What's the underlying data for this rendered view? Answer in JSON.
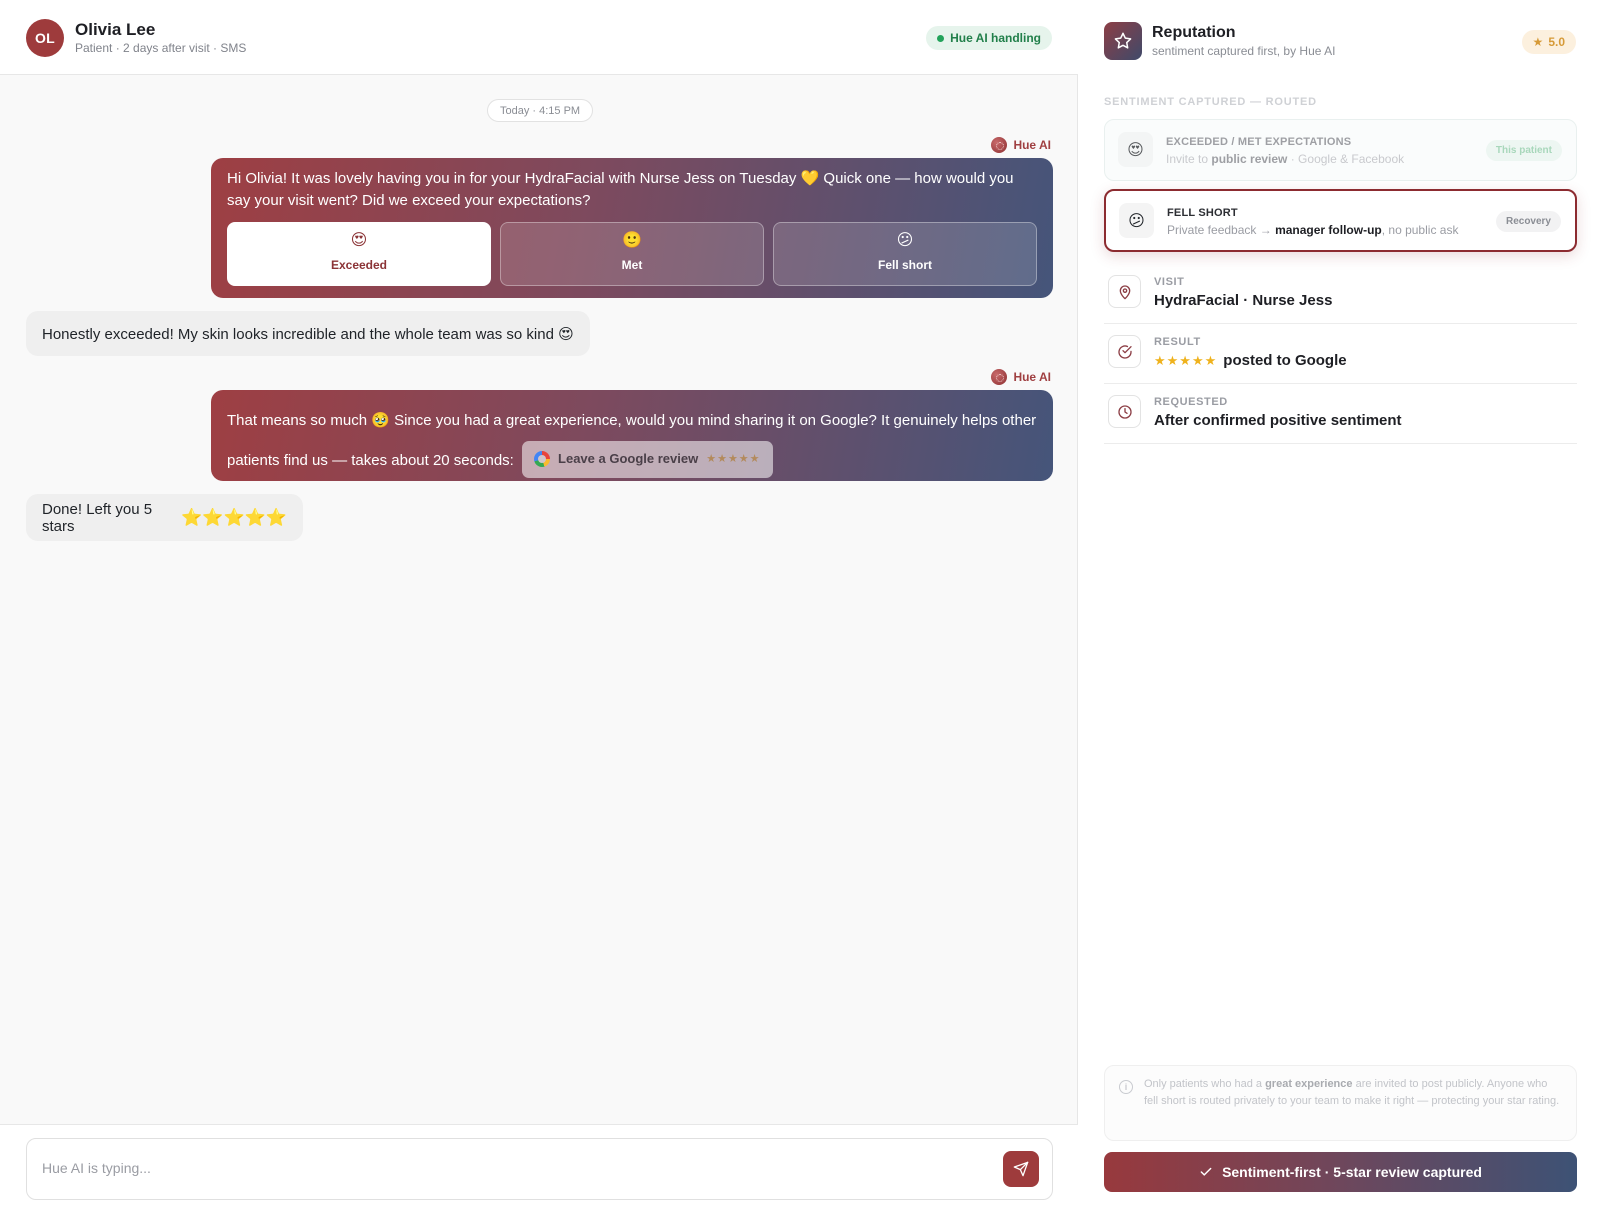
{
  "conversation": {
    "avatar_initials": "OL",
    "patient_name": "Olivia Lee",
    "patient_meta": "Patient · 2 days after visit · SMS",
    "status_badge": "Hue AI handling",
    "date_divider": "Today · 4:15 PM",
    "sender_name": "Hue AI",
    "messages": {
      "ai_1": "Hi Olivia! It was lovely having you in for your HydraFacial with Nurse Jess on Tuesday 💛 Quick one — how would you say your visit went? Did we exceed your expectations?",
      "choices": [
        {
          "emoji": "😍",
          "label": "Exceeded"
        },
        {
          "emoji": "🙂",
          "label": "Met"
        },
        {
          "emoji": "😕",
          "label": "Fell short"
        }
      ],
      "user_1": "Honestly exceeded! My skin looks incredible and the whole team was so kind 😍",
      "ai_2": "That means so much 🥹 Since you had a great experience, would you mind sharing it on Google? It genuinely helps other patients find us — takes about 20 seconds:",
      "review_button": "Leave a Google review",
      "review_button_stars": "★★★★★",
      "user_2": "Done! Left you 5 stars",
      "user_2_stars": "⭐⭐⭐⭐⭐"
    },
    "composer_placeholder": "Hue AI is typing..."
  },
  "panel": {
    "title": "Reputation",
    "subtitle": "sentiment captured first, by Hue AI",
    "score": "5.0",
    "section_label": "SENTIMENT CAPTURED — ROUTED",
    "routes": [
      {
        "emoji": "😍",
        "title": "EXCEEDED / MET EXPECTATIONS",
        "desc_prefix": "Invite to ",
        "desc_bold": "public review",
        "desc_suffix": " · Google & Facebook",
        "tag": "This patient"
      },
      {
        "emoji": "😕",
        "title": "FELL SHORT",
        "desc_prefix": "Private feedback → ",
        "desc_bold": "manager follow-up",
        "desc_suffix": ", no public ask",
        "tag": "Recovery"
      }
    ],
    "details": [
      {
        "label": "VISIT",
        "value": "HydraFacial · Nurse Jess"
      },
      {
        "label": "RESULT",
        "stars": "★★★★★",
        "value": "posted to Google"
      },
      {
        "label": "REQUESTED",
        "value": "After confirmed positive sentiment"
      }
    ],
    "note": {
      "p1": "Only patients who had a ",
      "bold": "great experience",
      "p2": " are invited to post publicly. Anyone who fell short is routed privately to your team to make it right — protecting your star rating."
    },
    "cta_label": "Sentiment-first · 5-star review captured"
  },
  "colors": {
    "brand": "#9e3b3c",
    "gradient_end": "#45557a",
    "status_green": "#22804b",
    "star_gold": "#efb21d"
  },
  "icons": [
    "star-outline-icon",
    "map-pin-icon",
    "check-circle-icon",
    "clock-icon",
    "info-icon",
    "send-icon",
    "check-icon",
    "google-icon"
  ]
}
